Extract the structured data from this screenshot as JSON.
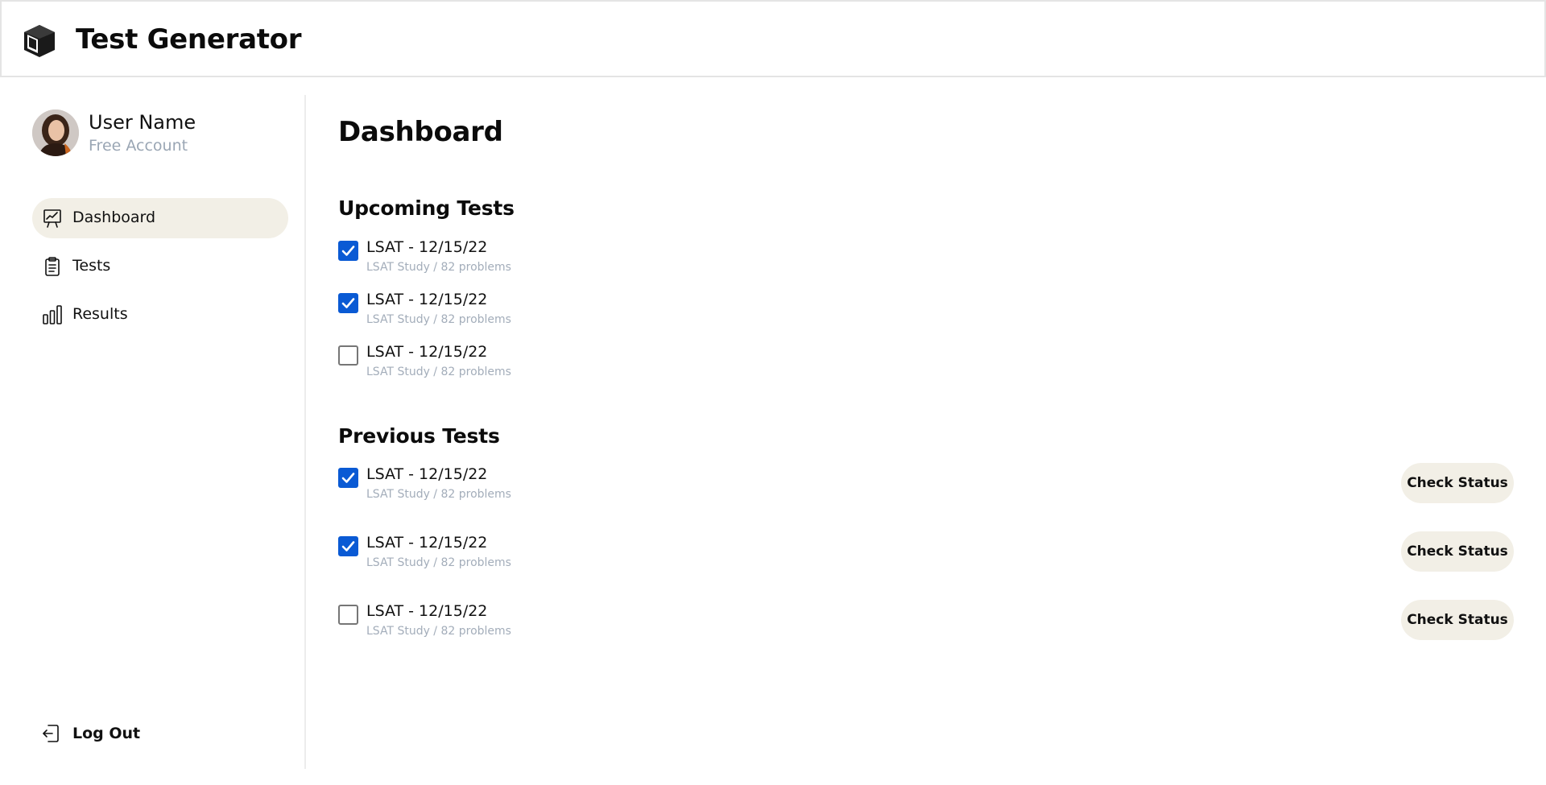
{
  "header": {
    "logo_icon": "cube-icon",
    "title": "Test Generator"
  },
  "sidebar": {
    "user": {
      "name": "User Name",
      "plan": "Free Account",
      "avatar_icon": "avatar-photo"
    },
    "items": [
      {
        "label": "Dashboard",
        "icon": "presentation-chart-icon",
        "active": true
      },
      {
        "label": "Tests",
        "icon": "clipboard-icon",
        "active": false
      },
      {
        "label": "Results",
        "icon": "bar-chart-icon",
        "active": false
      }
    ],
    "logout": {
      "label": "Log Out",
      "icon": "logout-icon"
    }
  },
  "main": {
    "title": "Dashboard",
    "upcoming": {
      "title": "Upcoming Tests",
      "tests": [
        {
          "title": "LSAT - 12/15/22",
          "subtitle": "LSAT Study / 82 problems",
          "checked": true
        },
        {
          "title": "LSAT - 12/15/22",
          "subtitle": "LSAT Study / 82 problems",
          "checked": true
        },
        {
          "title": "LSAT - 12/15/22",
          "subtitle": "LSAT Study / 82 problems",
          "checked": false
        }
      ]
    },
    "previous": {
      "title": "Previous Tests",
      "button_label": "Check Status",
      "tests": [
        {
          "title": "LSAT - 12/15/22",
          "subtitle": "LSAT Study / 82 problems",
          "checked": true
        },
        {
          "title": "LSAT - 12/15/22",
          "subtitle": "LSAT Study / 82 problems",
          "checked": true
        },
        {
          "title": "LSAT - 12/15/22",
          "subtitle": "LSAT Study / 82 problems",
          "checked": false
        }
      ]
    }
  },
  "colors": {
    "accent": "#0a5ad4",
    "active_bg": "#f2efe6",
    "muted_text": "#9aa6b4",
    "border": "#e4e4e4"
  }
}
